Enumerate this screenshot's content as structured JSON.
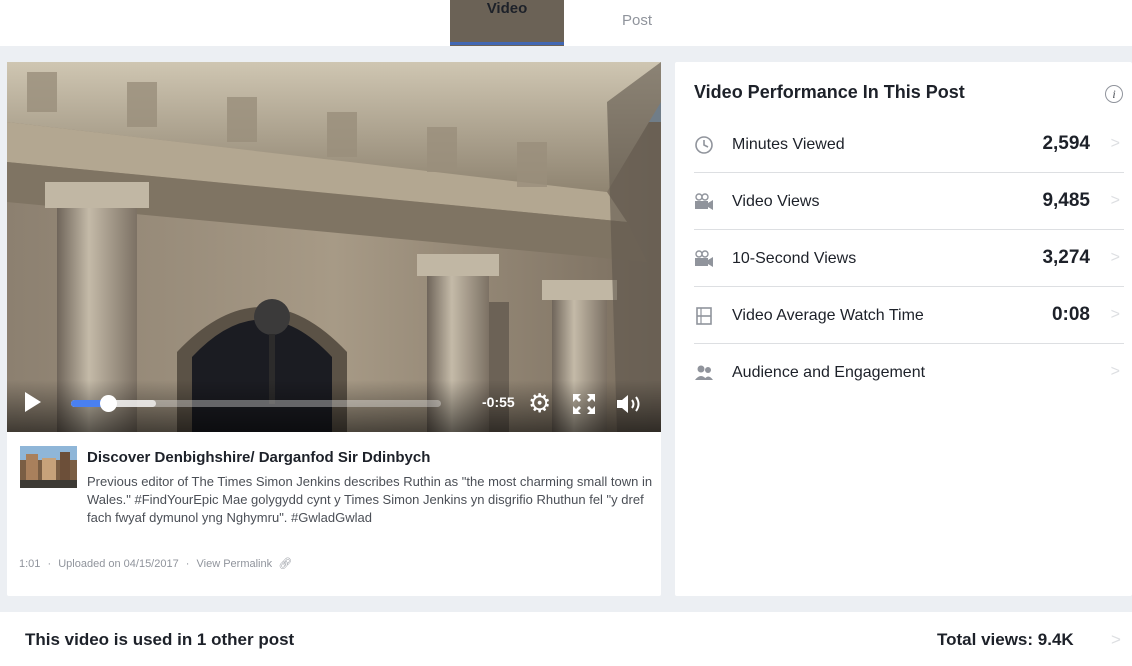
{
  "tabs": {
    "video": "Video",
    "post": "Post"
  },
  "player": {
    "time_remaining": "-0:55",
    "progress_fraction": 0.1,
    "buffered_fraction": 0.23
  },
  "video_info": {
    "title": "Discover Denbighshire/ Darganfod Sir Ddinbych",
    "description": "Previous editor of The Times Simon Jenkins describes Ruthin as \"the most charming small town in Wales.\" #FindYourEpic Mae golygydd cynt y Times Simon Jenkins yn disgrifio Rhuthun fel \"y dref fach fwyaf dymunol yng Nghymru\". #GwladGwlad",
    "duration": "1:01",
    "separator": "·",
    "uploaded": "Uploaded on 04/15/2017",
    "permalink": "View Permalink"
  },
  "performance": {
    "title": "Video Performance In This Post",
    "rows": [
      {
        "icon": "clock-icon",
        "label": "Minutes Viewed",
        "value": "2,594"
      },
      {
        "icon": "video-camera-icon",
        "label": "Video Views",
        "value": "9,485"
      },
      {
        "icon": "video-camera-icon",
        "label": "10-Second Views",
        "value": "3,274"
      },
      {
        "icon": "film-icon",
        "label": "Video Average Watch Time",
        "value": "0:08"
      },
      {
        "icon": "people-icon",
        "label": "Audience and Engagement",
        "value": ""
      }
    ]
  },
  "bottom": {
    "title": "This video is used in 1 other post",
    "total_views": "Total views: 9.4K"
  },
  "colors": {
    "accent": "#4267b2",
    "progress": "#4a80f0",
    "background": "#eceff3",
    "divider": "#dddfe2",
    "muted_text": "#90949c"
  }
}
